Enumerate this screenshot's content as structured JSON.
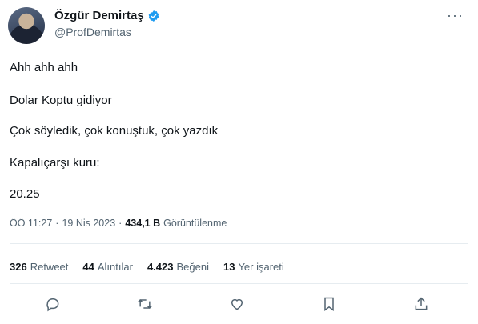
{
  "author": {
    "name": "Özgür Demirtaş",
    "handle": "@ProfDemirtas",
    "verified_icon": "verified-badge-icon"
  },
  "tweet": {
    "lines": [
      "Ahh ahh ahh",
      "Dolar Koptu gidiyor",
      "Çok söyledik, çok konuştuk, çok yazdık",
      "Kapalıçarşı kuru:",
      "20.25"
    ]
  },
  "meta": {
    "time": "ÖÖ 11:27",
    "separator": "·",
    "date": "19 Nis 2023",
    "views_count": "434,1 B",
    "views_label": "Görüntülenme"
  },
  "stats": {
    "retweets": {
      "count": "326",
      "label": "Retweet"
    },
    "quotes": {
      "count": "44",
      "label": "Alıntılar"
    },
    "likes": {
      "count": "4.423",
      "label": "Beğeni"
    },
    "bookmarks": {
      "count": "13",
      "label": "Yer işareti"
    }
  },
  "actions": [
    "reply-icon",
    "retweet-icon",
    "like-icon",
    "bookmark-icon",
    "share-icon"
  ],
  "colors": {
    "accent": "#1d9bf0",
    "muted": "#536471",
    "text": "#0f1419"
  }
}
